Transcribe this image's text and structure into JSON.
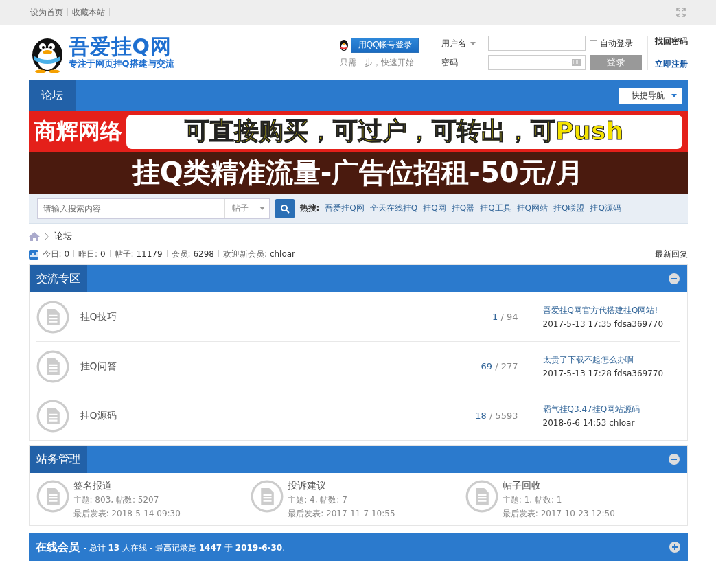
{
  "topbar": {
    "links": [
      "设为首页",
      "收藏本站"
    ]
  },
  "logo": {
    "title": "吾爱挂Q网",
    "subtitle": "专注于网页挂Q搭建与交流"
  },
  "qq_login": {
    "button": "用QQ帐号登录",
    "hint": "只需一步，快速开始"
  },
  "login": {
    "username_label": "用户名",
    "password_label": "密码",
    "auto_login": {
      "label": "自动登录",
      "checked": false
    },
    "submit": "登录",
    "forgot": "找回密码",
    "register": "立即注册"
  },
  "nav": {
    "items": [
      {
        "label": "论坛",
        "selected": true
      }
    ],
    "quick_nav": "快捷导航"
  },
  "banner": {
    "brand": "商辉网络",
    "slogan": "可直接购买，可过户，可转出，可Push",
    "offer": "挂Q类精准流量-广告位招租-50元/月"
  },
  "search": {
    "placeholder": "请输入搜索内容",
    "scope": "帖子",
    "hot_label": "热搜:",
    "hot": [
      "吾爱挂Q网",
      "全天在线挂Q",
      "挂Q网",
      "挂Q器",
      "挂Q工具",
      "挂Q网站",
      "挂Q联盟",
      "挂Q源码"
    ]
  },
  "breadcrumb": [
    "论坛"
  ],
  "stats": [
    {
      "label": "今日:",
      "value": "0"
    },
    {
      "label": "昨日:",
      "value": "0"
    },
    {
      "label": "帖子:",
      "value": "11179"
    },
    {
      "label": "会员:",
      "value": "6298"
    },
    {
      "label": "欢迎新会员:",
      "value": "chloar"
    }
  ],
  "latest_link": "最新回复",
  "count_separator": "/",
  "sections": [
    {
      "title": "交流专区",
      "collapsed": false,
      "kind": "list",
      "forums": [
        {
          "name": "挂Q技巧",
          "threads": "1",
          "posts": "94",
          "last_title": "吾爱挂Q网官方代搭建挂Q网站!",
          "last_meta": "2017-5-13 17:35 fdsa369770"
        },
        {
          "name": "挂Q问答",
          "threads": "69",
          "posts": "277",
          "last_title": "太贵了下载不起怎么办啊",
          "last_meta": "2017-5-13 17:28 fdsa369770"
        },
        {
          "name": "挂Q源码",
          "threads": "18",
          "posts": "5593",
          "last_title": "霸气挂Q3.47挂Q网站源码",
          "last_meta": "2018-6-6 14:53 chloar"
        }
      ]
    },
    {
      "title": "站务管理",
      "collapsed": false,
      "kind": "grid",
      "forums": [
        {
          "name": "签名报道",
          "counts": "主题: 803, 帖数: 5207",
          "last": "最后发表: 2018-5-14 09:30"
        },
        {
          "name": "投诉建议",
          "counts": "主题: 4, 帖数: 7",
          "last": "最后发表: 2017-11-7 10:55"
        },
        {
          "name": "帖子回收",
          "counts": "主题: 1, 帖数: 1",
          "last": "最后发表: 2017-10-23 12:50"
        }
      ]
    }
  ],
  "online": {
    "title": "在线会员",
    "summary": "- 总计 **13** 人在线 - 最高记录是 **1447** 于 **2019-6-30**.",
    "collapsed": true
  }
}
